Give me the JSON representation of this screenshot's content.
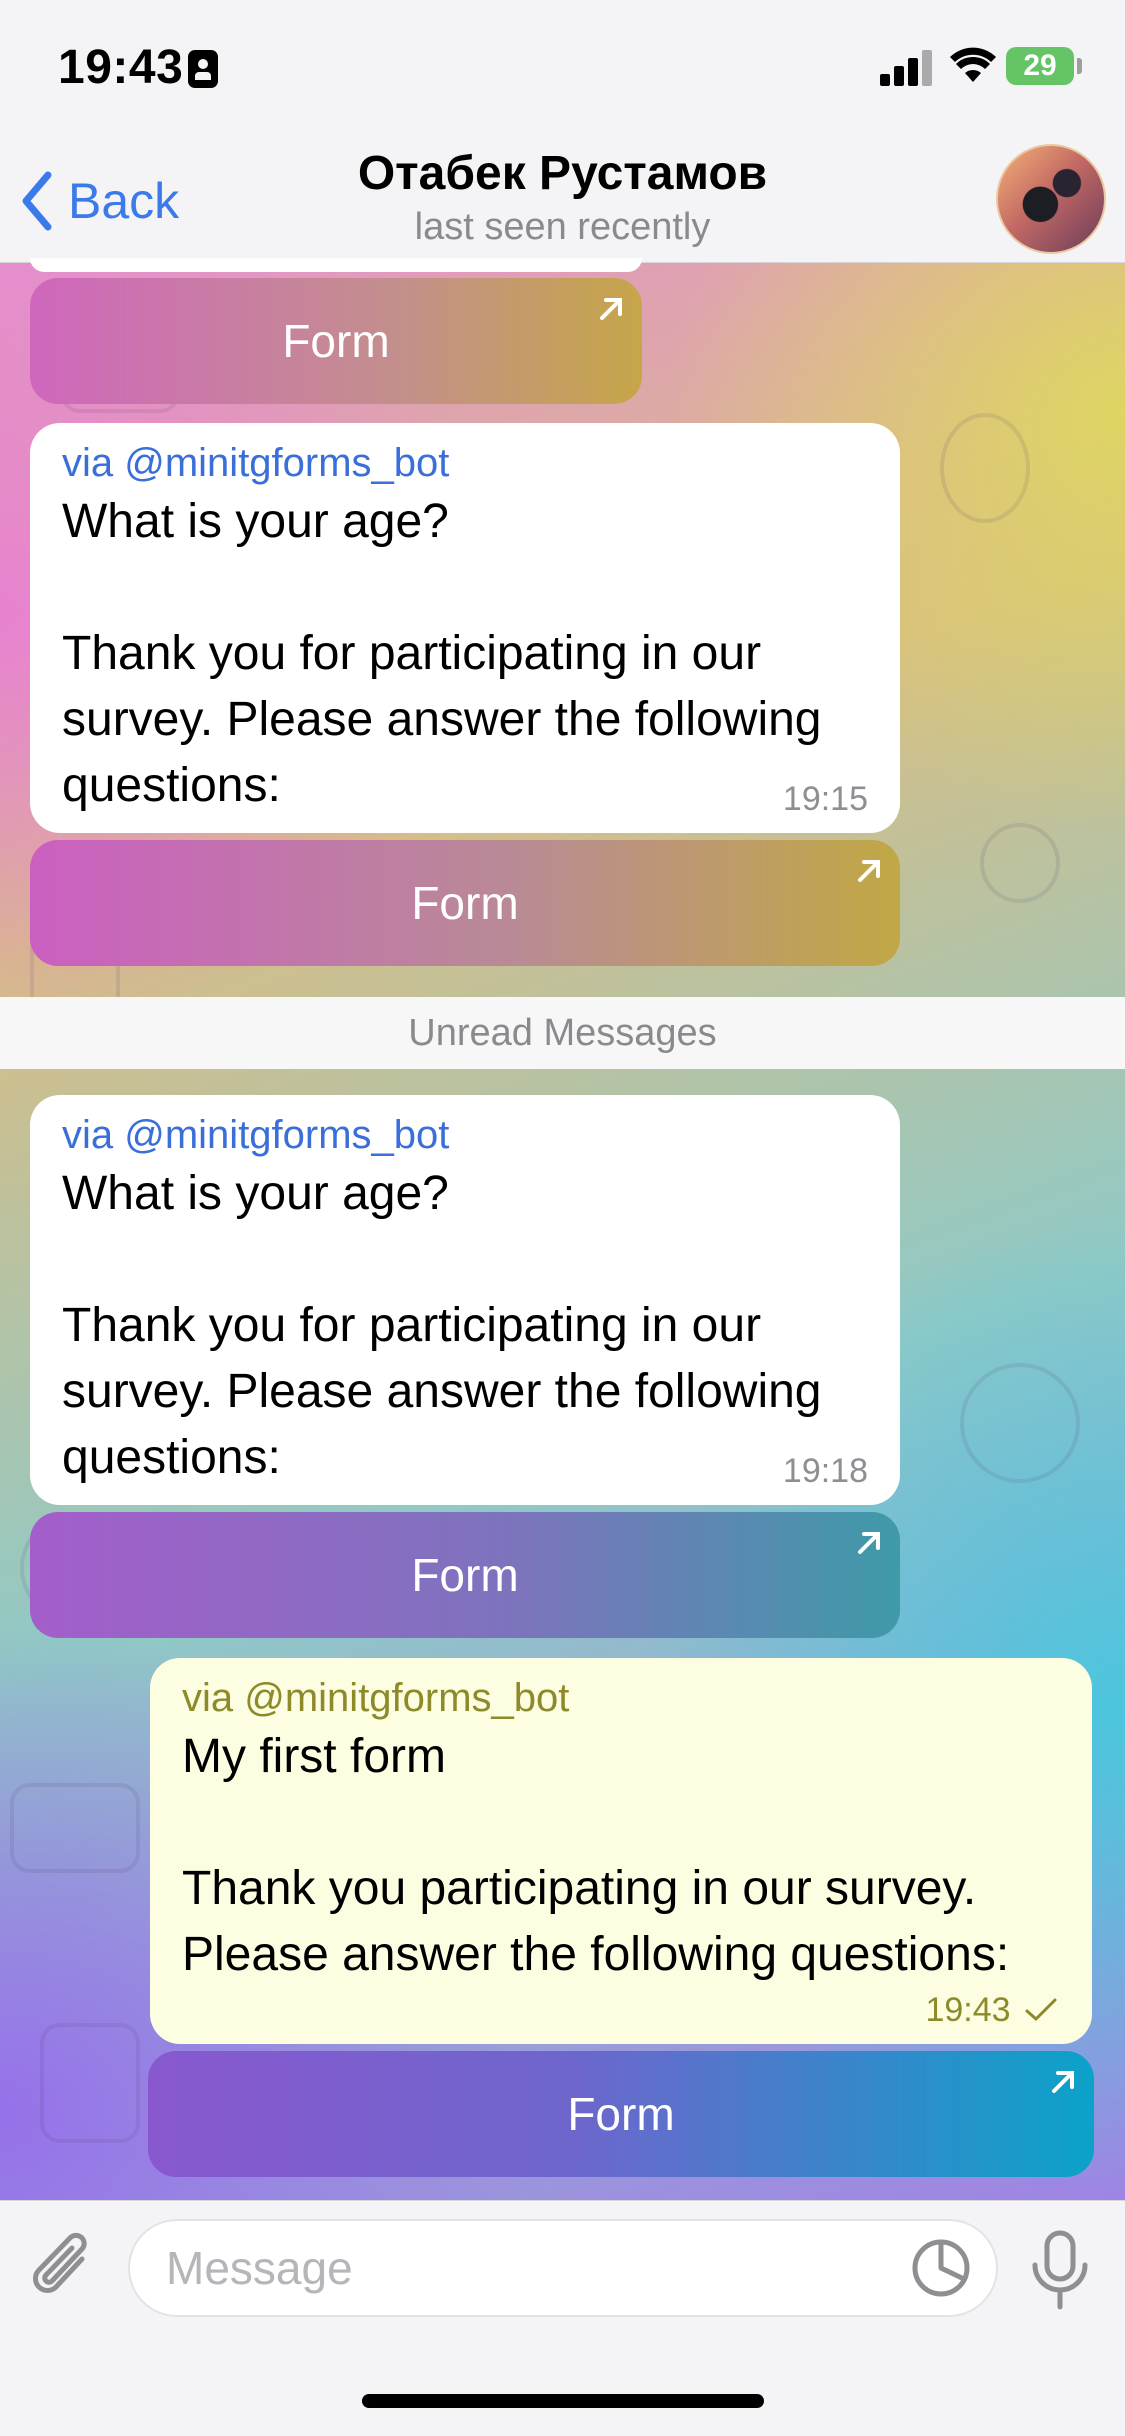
{
  "status_bar": {
    "time": "19:43",
    "battery": "29"
  },
  "header": {
    "back_label": "Back",
    "title": "Отабек Рустамов",
    "subtitle": "last seen recently"
  },
  "messages": [
    {
      "button_label": "Form"
    },
    {
      "via": "via @minitgforms_bot",
      "text": "What is your age?\n\nThank you for participating in our survey. Please answer the following questions:",
      "time": "19:15",
      "button_label": "Form"
    },
    {
      "via": "via @minitgforms_bot",
      "text": "What is your age?\n\nThank you for participating in our survey. Please answer the following questions:",
      "time": "19:18",
      "button_label": "Form"
    },
    {
      "via": "via @minitgforms_bot",
      "text": "My first form\n\nThank you participating in our survey. Please answer the following questions:",
      "time": "19:43",
      "button_label": "Form"
    }
  ],
  "unread_label": "Unread Messages",
  "composer": {
    "placeholder": "Message"
  },
  "colors": {
    "accent": "#3b7be9",
    "outgoing_bubble": "#fdfde1",
    "battery": "#65c466"
  }
}
